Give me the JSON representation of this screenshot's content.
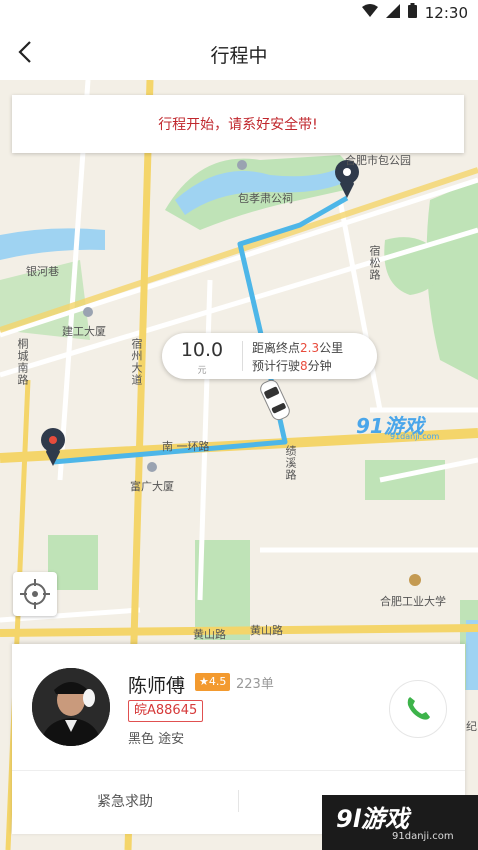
{
  "status_bar": {
    "time": "12:30"
  },
  "nav": {
    "title": "行程中"
  },
  "notice": "行程开始，请系好安全带!",
  "trip_info": {
    "price": "10.0",
    "price_unit": "元",
    "distance_prefix": "距离终点",
    "distance_value": "2.3",
    "distance_suffix": "公里",
    "eta_prefix": "预计行驶",
    "eta_value": "8",
    "eta_suffix": "分钟"
  },
  "map_labels": {
    "park": "合肥市包公园",
    "memorial": "包孝肃公祠",
    "yinhe": "银河巷",
    "jiangong": "建工大厦",
    "tongcheng": "桐城南路",
    "suzhou": "宿州大道",
    "huanlu": "南 一环路",
    "guangfu": "富广大厦",
    "sutai": "宿松路",
    "guweilu": "绩溪路",
    "university": "合肥工业大学",
    "huangshan1": "黄山路",
    "huangshan2": "黄山路",
    "jinan": "纪"
  },
  "watermark": {
    "top_main": "91游戏",
    "top_sub": "91danji.com",
    "bottom_main": "9l游戏",
    "bottom_sub": "91danji.com"
  },
  "driver": {
    "name": "陈师傅",
    "rating": "★4.5",
    "orders": "223单",
    "plate": "皖A88645",
    "car": "黑色 途安"
  },
  "actions": {
    "emergency": "紧急求助"
  },
  "colors": {
    "route": "#4db6e8",
    "accent_red": "#c0272d",
    "rating_bg": "#f39a2f",
    "call_green": "#3db34a"
  }
}
